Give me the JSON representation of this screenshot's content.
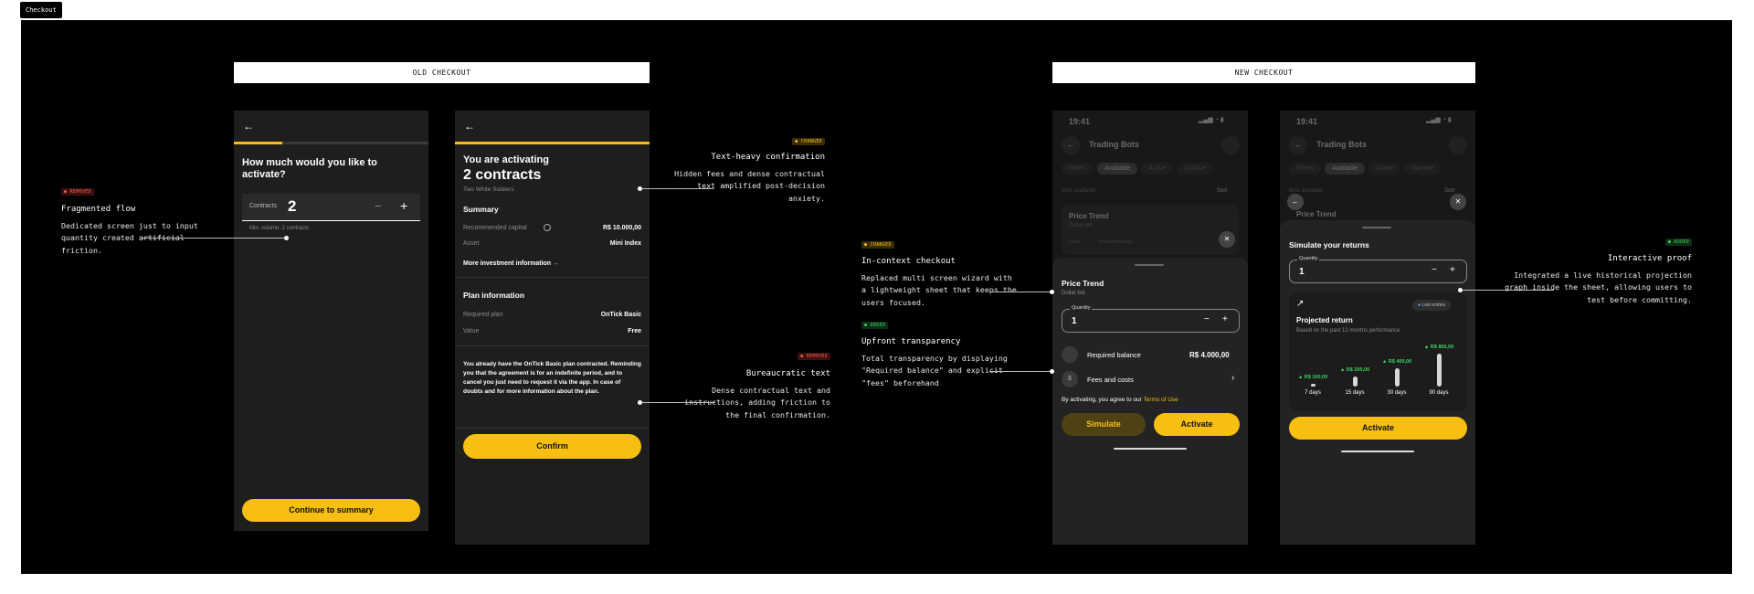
{
  "frame_label": "Checkout",
  "old": {
    "banner": "OLD CHECKOUT",
    "screen1": {
      "question": "How much would you like to activate?",
      "contracts_label": "Contracts",
      "contracts_value": "2",
      "minus": "−",
      "plus": "+",
      "min_volume": "Min. volume: 2 contracts",
      "cta": "Continue to summary",
      "progress": 0.25
    },
    "screen2": {
      "heading": "You are activating",
      "count": "2 contracts",
      "subtitle": "Two White Soldiers",
      "summary_title": "Summary",
      "rows": [
        {
          "label": "Recommended capital",
          "value": "R$ 10.000,00"
        },
        {
          "label": "Asset",
          "value": "Mini Index"
        }
      ],
      "more_link": "More investment information",
      "plan_title": "Plan information",
      "plan_rows": [
        {
          "label": "Required plan",
          "value": "OnTick Basic"
        },
        {
          "label": "Value",
          "value": "Free"
        }
      ],
      "legal": "You already have the OnTick Basic plan contracted. Reminding you that the agreement is for an indefinite period, and to cancel you just need to request it via the app. In case of doubts and for more information about the plan.",
      "cta": "Confirm"
    }
  },
  "new": {
    "banner": "NEW CHECKOUT",
    "screen3": {
      "time": "19:41",
      "title": "Trading Bots",
      "chips": [
        "Filters",
        "Available",
        "Active",
        "Inactive"
      ],
      "bots_available": "Bots available",
      "sort": "Sort",
      "card_title": "Price Trend",
      "card_sub": "Dollar bot",
      "card_tags": [
        "Gold",
        "Trend following"
      ],
      "sheet_title": "Price Trend",
      "sheet_sub": "Dollar bot",
      "qty_label": "Quantity",
      "qty_value": "1",
      "balance_label": "Required balance",
      "balance_value": "R$ 4.000,00",
      "fees_label": "Fees and costs",
      "agree_text": "By activating, you agree to our ",
      "terms": "Terms of Use",
      "simulate": "Simulate",
      "activate": "Activate"
    },
    "screen4": {
      "time": "19:41",
      "title": "Trading Bots",
      "chips": [
        "Filters",
        "Available",
        "Active",
        "Inactive"
      ],
      "bots_available": "Bots available",
      "sort": "Sort",
      "card_title": "Price Trend",
      "sheet_title": "Simulate your returns",
      "qty_label": "Quantity",
      "qty_value": "1",
      "badge": "Last entries",
      "proj_title": "Projected return",
      "proj_sub": "Based on the past 12 months performance",
      "bars": [
        {
          "label": "7 days",
          "value": "▲ R$ 100,00",
          "level": 0.05
        },
        {
          "label": "15 days",
          "value": "▲ R$ 200,00",
          "level": 0.3
        },
        {
          "label": "30 days",
          "value": "▲ R$ 400,00",
          "level": 0.55
        },
        {
          "label": "90 days",
          "value": "▲ R$ 800,00",
          "level": 1.0
        }
      ],
      "activate": "Activate"
    }
  },
  "annotations": [
    {
      "tag": "● REMOVED",
      "title": "Fragmented flow",
      "body": "Dedicated screen just to input quantity created artificial friction."
    },
    {
      "tag": "● CHANGED",
      "title": "Text-heavy confirmation",
      "body": "Hidden fees and dense contractual text amplified post-decision anxiety."
    },
    {
      "tag": "● REMOVED",
      "title": "Bureaucratic text",
      "body": "Dense contractual text and instructions, adding friction to the final confirmation."
    },
    {
      "tag": "● CHANGED",
      "title": "In-context checkout",
      "body": "Replaced multi screen wizard with a lightweight sheet that keeps the users focused."
    },
    {
      "tag": "● ADDED",
      "title": "Upfront transparency",
      "body": "Total transparency by displaying \"Required balance\" and explicit \"fees\" beforehand"
    },
    {
      "tag": "● ADDED",
      "title": "Interactive proof",
      "body": "Integrated a live historical projection graph inside the sheet, allowing users to test before committing."
    }
  ]
}
